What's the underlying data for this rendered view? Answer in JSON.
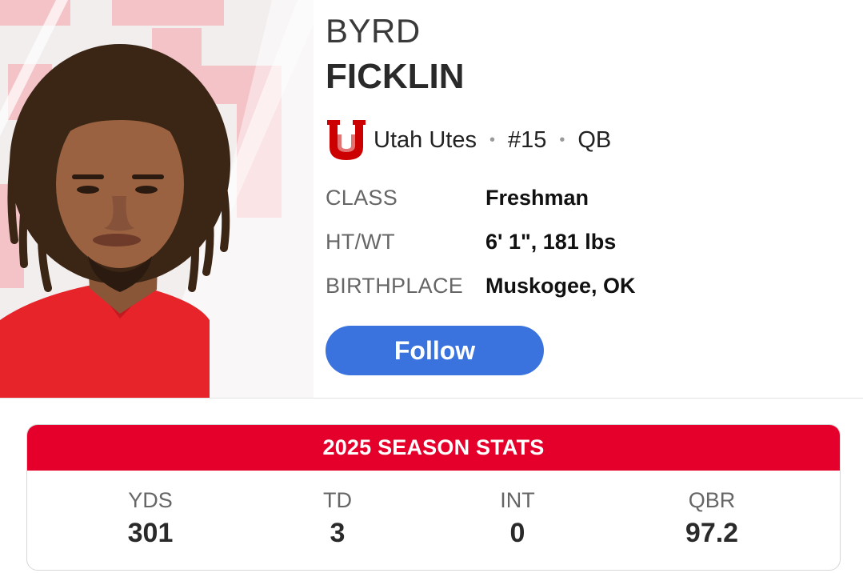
{
  "player": {
    "first_name": "BYRD",
    "last_name": "FICKLIN",
    "team": "Utah Utes",
    "number": "#15",
    "position": "QB",
    "separator": "•"
  },
  "details": [
    {
      "label": "CLASS",
      "value": "Freshman"
    },
    {
      "label": "HT/WT",
      "value": "6' 1\", 181 lbs"
    },
    {
      "label": "BIRTHPLACE",
      "value": "Muskogee, OK"
    }
  ],
  "follow_button": {
    "label": "Follow"
  },
  "stats": {
    "title": "2025 SEASON STATS",
    "items": [
      {
        "label": "YDS",
        "value": "301"
      },
      {
        "label": "TD",
        "value": "3"
      },
      {
        "label": "INT",
        "value": "0"
      },
      {
        "label": "QBR",
        "value": "97.2"
      }
    ]
  },
  "colors": {
    "team_red": "#e4002b",
    "follow_blue": "#3a73de",
    "background": "#ffffff"
  },
  "icons": {
    "team_logo": "utah-block-u-logo"
  }
}
